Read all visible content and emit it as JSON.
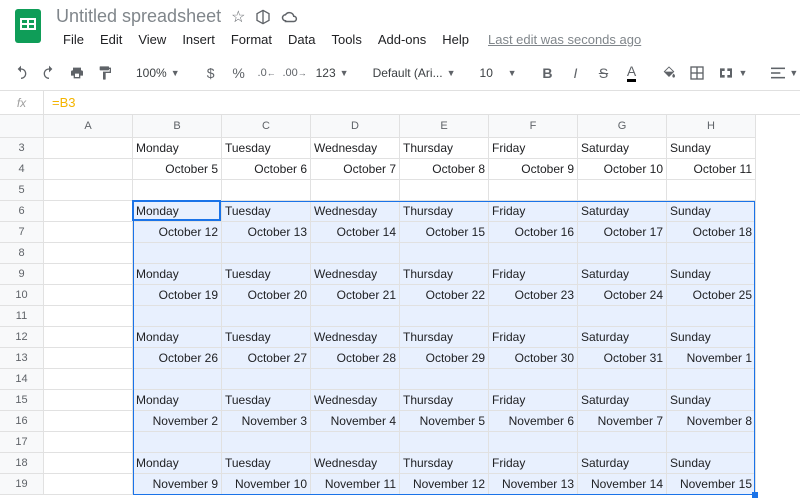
{
  "title": "Untitled spreadsheet",
  "menu": [
    "File",
    "Edit",
    "View",
    "Insert",
    "Format",
    "Data",
    "Tools",
    "Add-ons",
    "Help"
  ],
  "last_edit": "Last edit was seconds ago",
  "toolbar": {
    "zoom": "100%",
    "currency": "$",
    "percent": "%",
    "dec_dec": ".0",
    "inc_dec": ".00",
    "more_fmt": "123",
    "font": "Default (Ari...",
    "font_size": "10",
    "bold": "B",
    "italic": "I",
    "strike": "S",
    "text_color": "A"
  },
  "fx": {
    "label": "fx",
    "value": "=B3"
  },
  "columns": [
    "A",
    "B",
    "C",
    "D",
    "E",
    "F",
    "G",
    "H"
  ],
  "row_nums": [
    "3",
    "4",
    "5",
    "6",
    "7",
    "8",
    "9",
    "10",
    "11",
    "12",
    "13",
    "14",
    "15",
    "16",
    "17",
    "18",
    "19"
  ],
  "days": [
    "Monday",
    "Tuesday",
    "Wednesday",
    "Thursday",
    "Friday",
    "Saturday",
    "Sunday"
  ],
  "blocks": [
    {
      "dates": [
        "October 5",
        "October 6",
        "October 7",
        "October 8",
        "October 9",
        "October 10",
        "October 11"
      ]
    },
    {
      "dates": [
        "October 12",
        "October 13",
        "October 14",
        "October 15",
        "October 16",
        "October 17",
        "October 18"
      ]
    },
    {
      "dates": [
        "October 19",
        "October 20",
        "October 21",
        "October 22",
        "October 23",
        "October 24",
        "October 25"
      ]
    },
    {
      "dates": [
        "October 26",
        "October 27",
        "October 28",
        "October 29",
        "October 30",
        "October 31",
        "November 1"
      ]
    },
    {
      "dates": [
        "November 2",
        "November 3",
        "November 4",
        "November 5",
        "November 6",
        "November 7",
        "November 8"
      ]
    },
    {
      "dates": [
        "November 9",
        "November 10",
        "November 11",
        "November 12",
        "November 13",
        "November 14",
        "November 15"
      ]
    }
  ],
  "chart_data": {
    "type": "table",
    "active_cell": "B6",
    "selection": "B6:H19",
    "columns": [
      "",
      "B",
      "C",
      "D",
      "E",
      "F",
      "G",
      "H"
    ],
    "rows": [
      [
        "3",
        "Monday",
        "Tuesday",
        "Wednesday",
        "Thursday",
        "Friday",
        "Saturday",
        "Sunday"
      ],
      [
        "4",
        "October 5",
        "October 6",
        "October 7",
        "October 8",
        "October 9",
        "October 10",
        "October 11"
      ],
      [
        "5",
        "",
        "",
        "",
        "",
        "",
        "",
        ""
      ],
      [
        "6",
        "Monday",
        "Tuesday",
        "Wednesday",
        "Thursday",
        "Friday",
        "Saturday",
        "Sunday"
      ],
      [
        "7",
        "October 12",
        "October 13",
        "October 14",
        "October 15",
        "October 16",
        "October 17",
        "October 18"
      ],
      [
        "8",
        "",
        "",
        "",
        "",
        "",
        "",
        ""
      ],
      [
        "9",
        "Monday",
        "Tuesday",
        "Wednesday",
        "Thursday",
        "Friday",
        "Saturday",
        "Sunday"
      ],
      [
        "10",
        "October 19",
        "October 20",
        "October 21",
        "October 22",
        "October 23",
        "October 24",
        "October 25"
      ],
      [
        "11",
        "",
        "",
        "",
        "",
        "",
        "",
        ""
      ],
      [
        "12",
        "Monday",
        "Tuesday",
        "Wednesday",
        "Thursday",
        "Friday",
        "Saturday",
        "Sunday"
      ],
      [
        "13",
        "October 26",
        "October 27",
        "October 28",
        "October 29",
        "October 30",
        "October 31",
        "November 1"
      ],
      [
        "14",
        "",
        "",
        "",
        "",
        "",
        "",
        ""
      ],
      [
        "15",
        "Monday",
        "Tuesday",
        "Wednesday",
        "Thursday",
        "Friday",
        "Saturday",
        "Sunday"
      ],
      [
        "16",
        "November 2",
        "November 3",
        "November 4",
        "November 5",
        "November 6",
        "November 7",
        "November 8"
      ],
      [
        "17",
        "",
        "",
        "",
        "",
        "",
        "",
        ""
      ],
      [
        "18",
        "Monday",
        "Tuesday",
        "Wednesday",
        "Thursday",
        "Friday",
        "Saturday",
        "Sunday"
      ],
      [
        "19",
        "November 9",
        "November 10",
        "November 11",
        "November 12",
        "November 13",
        "November 14",
        "November 15"
      ]
    ]
  }
}
